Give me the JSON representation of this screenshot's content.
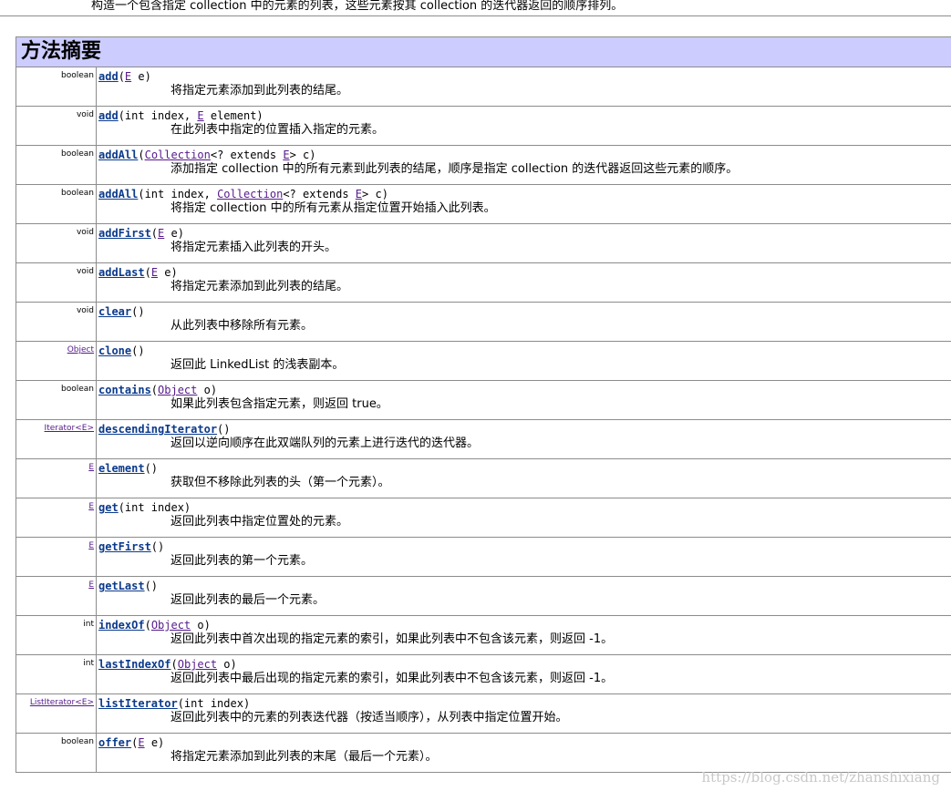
{
  "top_description": "构造一个包含指定 collection 中的元素的列表，这些元素按其 collection 的迭代器返回的顺序排列。",
  "section_title": "方法摘要",
  "methods": [
    {
      "type": "boolean",
      "type_link": false,
      "name": "add",
      "sig": [
        {
          "t": "(",
          "k": "p"
        },
        {
          "t": "E",
          "k": "ref"
        },
        {
          "t": " e)",
          "k": "p"
        }
      ],
      "desc": "将指定元素添加到此列表的结尾。"
    },
    {
      "type": "void",
      "type_link": false,
      "name": "add",
      "sig": [
        {
          "t": "(int index, ",
          "k": "p"
        },
        {
          "t": "E",
          "k": "ref"
        },
        {
          "t": " element)",
          "k": "p"
        }
      ],
      "desc": "在此列表中指定的位置插入指定的元素。"
    },
    {
      "type": "boolean",
      "type_link": false,
      "name": "addAll",
      "sig": [
        {
          "t": "(",
          "k": "p"
        },
        {
          "t": "Collection",
          "k": "ref"
        },
        {
          "t": "<? extends ",
          "k": "p"
        },
        {
          "t": "E",
          "k": "ref"
        },
        {
          "t": "> c)",
          "k": "p"
        }
      ],
      "desc": "添加指定 collection 中的所有元素到此列表的结尾，顺序是指定 collection 的迭代器返回这些元素的顺序。"
    },
    {
      "type": "boolean",
      "type_link": false,
      "name": "addAll",
      "sig": [
        {
          "t": "(int index, ",
          "k": "p"
        },
        {
          "t": "Collection",
          "k": "ref"
        },
        {
          "t": "<? extends ",
          "k": "p"
        },
        {
          "t": "E",
          "k": "ref"
        },
        {
          "t": "> c)",
          "k": "p"
        }
      ],
      "desc": "将指定 collection 中的所有元素从指定位置开始插入此列表。"
    },
    {
      "type": "void",
      "type_link": false,
      "name": "addFirst",
      "sig": [
        {
          "t": "(",
          "k": "p"
        },
        {
          "t": "E",
          "k": "ref"
        },
        {
          "t": " e)",
          "k": "p"
        }
      ],
      "desc": "将指定元素插入此列表的开头。"
    },
    {
      "type": "void",
      "type_link": false,
      "name": "addLast",
      "sig": [
        {
          "t": "(",
          "k": "p"
        },
        {
          "t": "E",
          "k": "ref"
        },
        {
          "t": " e)",
          "k": "p"
        }
      ],
      "desc": "将指定元素添加到此列表的结尾。"
    },
    {
      "type": "void",
      "type_link": false,
      "name": "clear",
      "sig": [
        {
          "t": "()",
          "k": "p"
        }
      ],
      "desc": "从此列表中移除所有元素。"
    },
    {
      "type": "Object",
      "type_link": true,
      "name": "clone",
      "sig": [
        {
          "t": "()",
          "k": "p"
        }
      ],
      "desc": "返回此 LinkedList 的浅表副本。"
    },
    {
      "type": "boolean",
      "type_link": false,
      "name": "contains",
      "sig": [
        {
          "t": "(",
          "k": "p"
        },
        {
          "t": "Object",
          "k": "ref"
        },
        {
          "t": " o)",
          "k": "p"
        }
      ],
      "desc": "如果此列表包含指定元素，则返回 true。"
    },
    {
      "type": "Iterator<E>",
      "type_link": true,
      "name": "descendingIterator",
      "sig": [
        {
          "t": "()",
          "k": "p"
        }
      ],
      "desc": "返回以逆向顺序在此双端队列的元素上进行迭代的迭代器。"
    },
    {
      "type": "E",
      "type_link": true,
      "name": "element",
      "sig": [
        {
          "t": "()",
          "k": "p"
        }
      ],
      "desc": "获取但不移除此列表的头（第一个元素）。"
    },
    {
      "type": "E",
      "type_link": true,
      "name": "get",
      "sig": [
        {
          "t": "(int index)",
          "k": "p"
        }
      ],
      "desc": "返回此列表中指定位置处的元素。"
    },
    {
      "type": "E",
      "type_link": true,
      "name": "getFirst",
      "sig": [
        {
          "t": "()",
          "k": "p"
        }
      ],
      "desc": "返回此列表的第一个元素。"
    },
    {
      "type": "E",
      "type_link": true,
      "name": "getLast",
      "sig": [
        {
          "t": "()",
          "k": "p"
        }
      ],
      "desc": "返回此列表的最后一个元素。"
    },
    {
      "type": "int",
      "type_link": false,
      "name": "indexOf",
      "sig": [
        {
          "t": "(",
          "k": "p"
        },
        {
          "t": "Object",
          "k": "ref"
        },
        {
          "t": " o)",
          "k": "p"
        }
      ],
      "desc": "返回此列表中首次出现的指定元素的索引，如果此列表中不包含该元素，则返回 -1。"
    },
    {
      "type": "int",
      "type_link": false,
      "name": "lastIndexOf",
      "sig": [
        {
          "t": "(",
          "k": "p"
        },
        {
          "t": "Object",
          "k": "ref"
        },
        {
          "t": " o)",
          "k": "p"
        }
      ],
      "desc": "返回此列表中最后出现的指定元素的索引，如果此列表中不包含该元素，则返回 -1。"
    },
    {
      "type": "ListIterator<E>",
      "type_link": true,
      "name": "listIterator",
      "sig": [
        {
          "t": "(int index)",
          "k": "p"
        }
      ],
      "desc": "返回此列表中的元素的列表迭代器（按适当顺序），从列表中指定位置开始。"
    },
    {
      "type": "boolean",
      "type_link": false,
      "name": "offer",
      "sig": [
        {
          "t": "(",
          "k": "p"
        },
        {
          "t": "E",
          "k": "ref"
        },
        {
          "t": " e)",
          "k": "p"
        }
      ],
      "desc": "将指定元素添加到此列表的末尾（最后一个元素）。"
    }
  ],
  "watermark": "https://blog.csdn.net/zhanshixiang"
}
